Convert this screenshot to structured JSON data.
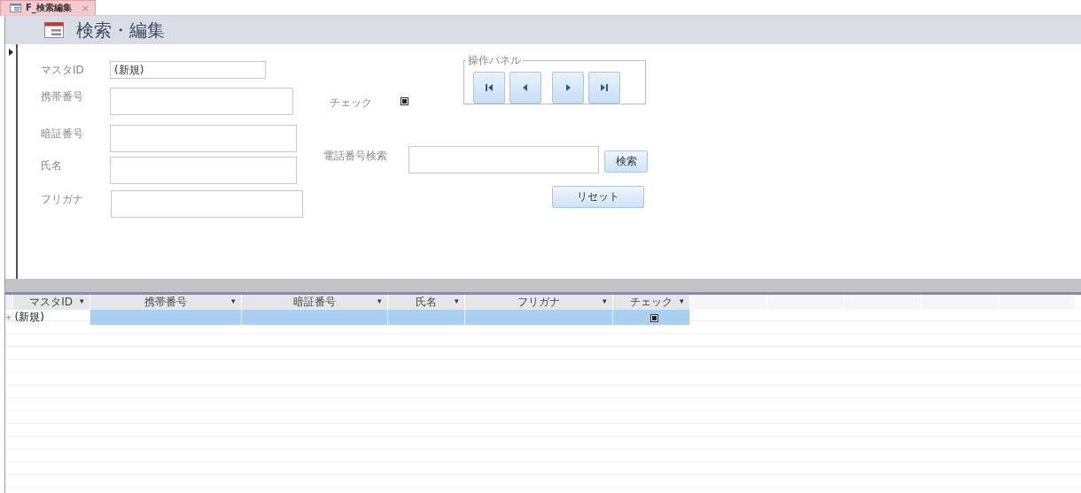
{
  "tab": {
    "label": "F_検索編集",
    "close": "×",
    "selected": true
  },
  "header": {
    "title": "検索・編集"
  },
  "form": {
    "fields": [
      {
        "label": "マスタID",
        "value": "(新規)"
      },
      {
        "label": "携帯番号"
      },
      {
        "label": "暗証番号"
      },
      {
        "label": "氏名"
      },
      {
        "label": "フリガナ"
      }
    ],
    "check": {
      "label": "チェック",
      "checked": true
    },
    "panel": {
      "title": "操作パネル",
      "buttons": [
        {
          "kind": "first"
        },
        {
          "kind": "previous"
        },
        {
          "kind": "next"
        },
        {
          "kind": "last"
        }
      ]
    },
    "search": {
      "label": "電話番号検索",
      "button": "検索"
    },
    "reset_button": "リセット"
  },
  "datasheet": {
    "columns": [
      {
        "label": "マスタID",
        "menu": "▾"
      },
      {
        "label": "携帯番号",
        "menu": "▾"
      },
      {
        "label": "暗証番号",
        "menu": "▾"
      },
      {
        "label": "氏名",
        "menu": "▾"
      },
      {
        "label": "フリガナ",
        "menu": "▾"
      },
      {
        "label": "チェック",
        "menu": "▾"
      }
    ],
    "rows": [
      {
        "marker": "✳",
        "selected": true,
        "cells": [
          "(新規)",
          "",
          "",
          "",
          ""
        ],
        "checked": true
      }
    ]
  }
}
